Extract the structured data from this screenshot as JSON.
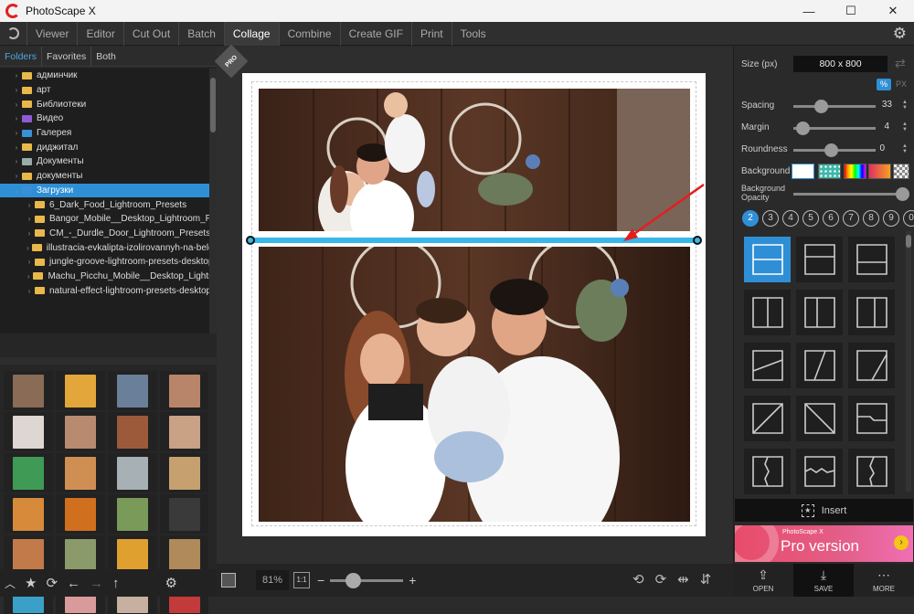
{
  "app": {
    "title": "PhotoScape X",
    "minimize": "—",
    "maximize": "☐",
    "close": "✕"
  },
  "menu": {
    "items": [
      "Viewer",
      "Editor",
      "Cut Out",
      "Batch",
      "Collage",
      "Combine",
      "Create GIF",
      "Print",
      "Tools"
    ],
    "active": "Collage"
  },
  "folder_tabs": [
    "Folders",
    "Favorites",
    "Both"
  ],
  "tree": [
    {
      "label": "админчик",
      "depth": 1,
      "icon": "folder"
    },
    {
      "label": "арт",
      "depth": 1,
      "icon": "folder"
    },
    {
      "label": "Библиотеки",
      "depth": 1,
      "icon": "folder"
    },
    {
      "label": "Видео",
      "depth": 1,
      "icon": "video"
    },
    {
      "label": "Галерея",
      "depth": 1,
      "icon": "gallery"
    },
    {
      "label": "диджитал",
      "depth": 1,
      "icon": "folder"
    },
    {
      "label": "Документы",
      "depth": 1,
      "icon": "docs"
    },
    {
      "label": "документы",
      "depth": 1,
      "icon": "folder"
    },
    {
      "label": "Загрузки",
      "depth": 1,
      "icon": "downloads",
      "selected": true
    },
    {
      "label": "6_Dark_Food_Lightroom_Presets",
      "depth": 2,
      "icon": "folder"
    },
    {
      "label": "Bangor_Mobile__Desktop_Lightroom_Pr",
      "depth": 2,
      "icon": "folder"
    },
    {
      "label": "CM_-_Durdle_Door_Lightroom_Presets_",
      "depth": 2,
      "icon": "folder"
    },
    {
      "label": "illustracia-evkalipta-izolirovannyh-na-belor",
      "depth": 2,
      "icon": "folder"
    },
    {
      "label": "jungle-groove-lightroom-presets-desktop",
      "depth": 2,
      "icon": "folder"
    },
    {
      "label": "Machu_Picchu_Mobile__Desktop_Lightro",
      "depth": 2,
      "icon": "folder"
    },
    {
      "label": "natural-effect-lightroom-presets-desktop",
      "depth": 2,
      "icon": "folder"
    }
  ],
  "thumb_colors": [
    "#8a6b55",
    "#e2a63a",
    "#6a7f9a",
    "#b9856a",
    "#ddd6d2",
    "#b88a70",
    "#9c5a3a",
    "#c9a185",
    "#3f9a55",
    "#d08f52",
    "#a7b0b5",
    "#c7a070",
    "#d68a3a",
    "#d0701f",
    "#7a9a5a",
    "#3a3a3a",
    "#c27a4a",
    "#8a9a6a",
    "#e0a030",
    "#b08a5a",
    "#3aa0c8",
    "#d89a9a",
    "#c7b0a0",
    "#c23a3a"
  ],
  "left_toolbar_icons": [
    "up-icon",
    "star-icon",
    "refresh-icon",
    "back-icon",
    "forward-icon",
    "parent-icon",
    "settings-icon"
  ],
  "canvas": {
    "badge": "PRO",
    "zoom": "81%",
    "ratio": "1:1"
  },
  "panel": {
    "size_label": "Size (px)",
    "size_value": "800 x 800",
    "unit_percent": "%",
    "unit_px": "PX",
    "spacing_label": "Spacing",
    "spacing_value": "33",
    "margin_label": "Margin",
    "margin_value": "4",
    "roundness_label": "Roundness",
    "roundness_value": "0",
    "background_label": "Background",
    "bg_opacity_label_1": "Background",
    "bg_opacity_label_2": "Opacity",
    "counts": [
      "2",
      "3",
      "4",
      "5",
      "6",
      "7",
      "8",
      "9",
      "0"
    ],
    "selected_count": "2",
    "insert_label": "Insert",
    "pro_small": "PhotoScape X",
    "pro_big": "Pro version"
  },
  "bottom_actions": {
    "open": "OPEN",
    "save": "SAVE",
    "more": "MORE"
  }
}
